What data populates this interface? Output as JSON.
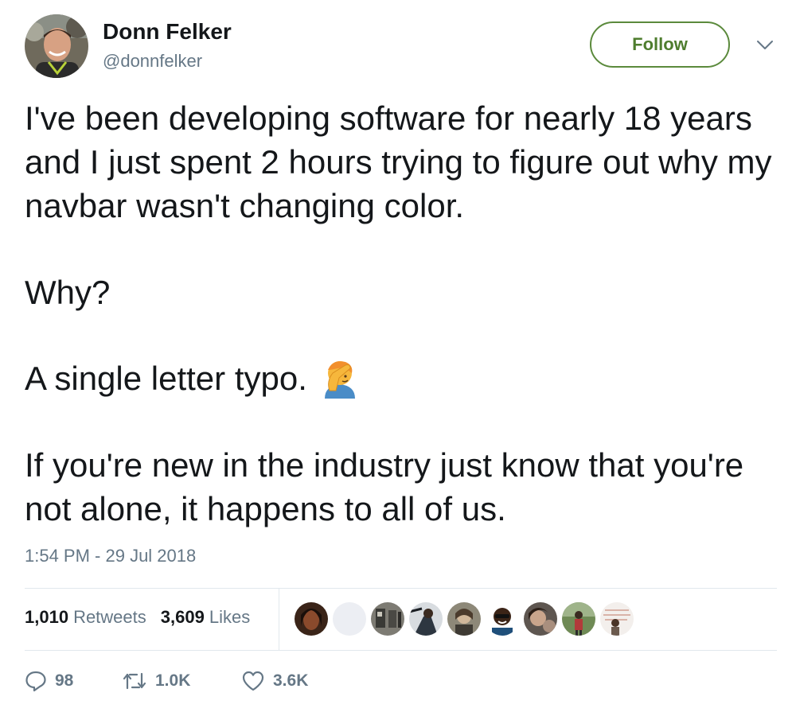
{
  "author": {
    "display_name": "Donn Felker",
    "handle": "@donnfelker"
  },
  "follow_button": {
    "label": "Follow"
  },
  "tweet": {
    "paragraphs": [
      "I've been developing software for nearly 18 years and I just spent 2 hours trying to figure out why my navbar wasn't changing color.",
      "Why?",
      "A single letter typo.",
      "If you're new in the industry just know that you're not alone, it happens to all of us."
    ],
    "emoji": "face-palm-emoji",
    "timestamp": "1:54 PM - 29 Jul 2018"
  },
  "stats": {
    "retweets_count": "1,010",
    "retweets_label": "Retweets",
    "likes_count": "3,609",
    "likes_label": "Likes"
  },
  "actions": {
    "reply_count": "98",
    "retweet_count": "1.0K",
    "like_count": "3.6K"
  },
  "icons": [
    "chevron-down-icon",
    "reply-icon",
    "retweet-icon",
    "heart-icon"
  ],
  "colors": {
    "follow_accent": "#5b8a3c",
    "secondary_text": "#657786",
    "primary_text": "#14171a",
    "divider": "#e1e8ed"
  }
}
